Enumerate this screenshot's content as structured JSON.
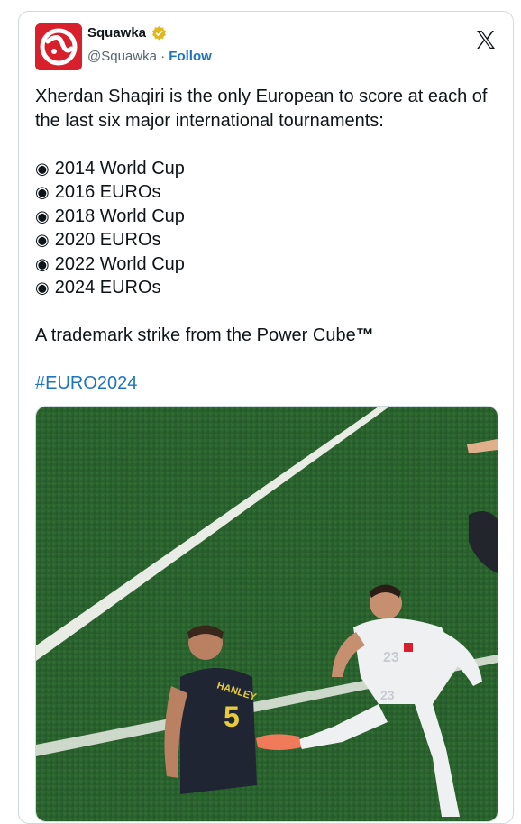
{
  "tweet": {
    "author_name": "Squawka",
    "handle": "@Squawka",
    "separator": "·",
    "follow_label": "Follow",
    "lines": {
      "intro": "Xherdan Shaqiri is the only European to score at each of the last six major international tournaments:",
      "bullets": [
        "2014 World Cup",
        "2016 EUROs",
        "2018 World Cup",
        "2020 EUROs",
        "2022 World Cup",
        "2024 EUROs"
      ],
      "bullet_symbol": "◉",
      "closing": "A trademark strike from the Power Cube",
      "closing_tm": "™",
      "hashtag": "#EURO2024"
    }
  },
  "icons": {
    "avatar": "squawka-logo",
    "verified": "verified-badge-icon",
    "platform": "x-logo-icon"
  },
  "colors": {
    "brand_red": "#d8202c",
    "link_blue": "#1d74bf",
    "pitch_green": "#2e6a2f",
    "badge_gold": "#e2b719"
  }
}
